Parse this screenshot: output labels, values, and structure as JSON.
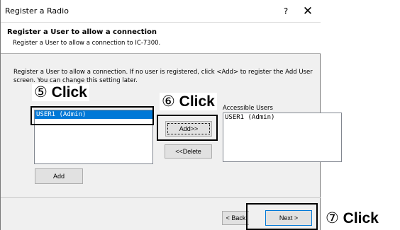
{
  "window": {
    "title": "Register a Radio",
    "help_label": "?",
    "close_label": "✕"
  },
  "header": {
    "title": "Register a User to allow a connection",
    "subtitle": "Register a User to allow a connection to IC-7300."
  },
  "instruction": "Register a User to allow a connection. If no user is registered, click <Add> to register the Add User screen. You can change this setting later.",
  "user_list": {
    "items": [
      "USER1 (Admin)"
    ],
    "selected_index": 0
  },
  "access_list": {
    "label": "Accessible Users",
    "items": [
      "USER1 (Admin)"
    ]
  },
  "buttons": {
    "add_to_access": "Add>>",
    "delete": "<<Delete",
    "add_user": "Add",
    "back": "< Back",
    "next": "Next >"
  },
  "callouts": {
    "step5_num": "⑤",
    "step5_text": "Click",
    "step6_num": "⑥",
    "step6_text": "Click",
    "step7_num": "⑦",
    "step7_text": "Click"
  },
  "colors": {
    "selection": "#0078d7",
    "dialog_bg": "#f0f0f0"
  }
}
